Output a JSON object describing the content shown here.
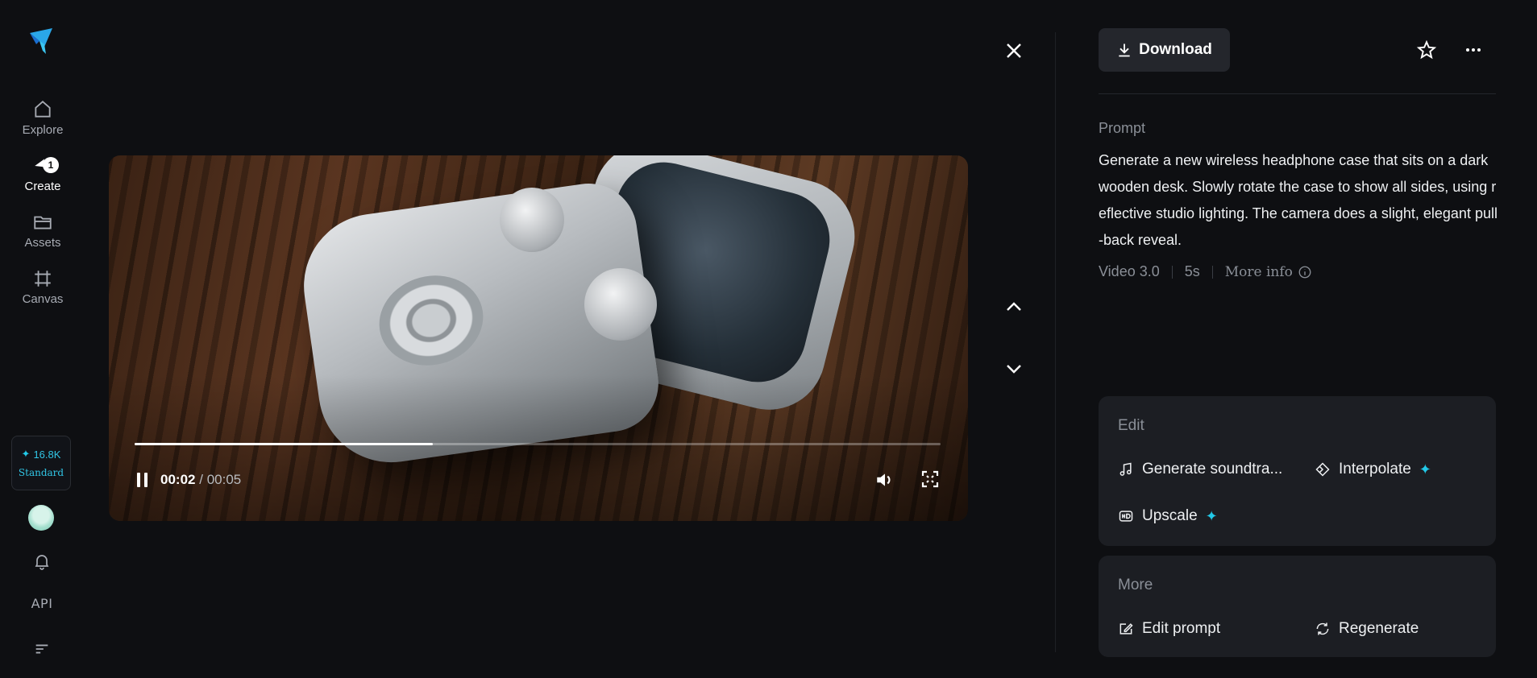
{
  "sidebar": {
    "logo": "brand-logo",
    "items": [
      {
        "label": "Explore",
        "icon": "home-icon"
      },
      {
        "label": "Create",
        "icon": "create-icon",
        "badge": "1"
      },
      {
        "label": "Assets",
        "icon": "folder-icon"
      },
      {
        "label": "Canvas",
        "icon": "canvas-icon"
      }
    ],
    "credits": {
      "amount": "16.8K",
      "plan": "Standard"
    },
    "api_label": "API"
  },
  "video": {
    "current_time": "00:02",
    "separator": "/",
    "total_time": "00:05",
    "progress": 0.37
  },
  "details": {
    "download_label": "Download",
    "prompt_label": "Prompt",
    "prompt_text": "Generate a new wireless headphone case that sits on a dark wooden desk. Slowly rotate the case to show all sides, using reflective studio lighting. The camera does a slight, elegant pull-back reveal.",
    "model": "Video 3.0",
    "duration": "5s",
    "more_info": "More info"
  },
  "edit_card": {
    "title": "Edit",
    "actions": [
      {
        "label": "Generate soundtra...",
        "icon": "music-note-icon"
      },
      {
        "label": "Interpolate",
        "icon": "interpolate-icon",
        "premium": true
      },
      {
        "label": "Upscale",
        "icon": "hd-icon",
        "premium": true
      }
    ]
  },
  "more_card": {
    "title": "More",
    "actions": [
      {
        "label": "Edit prompt",
        "icon": "edit-prompt-icon"
      },
      {
        "label": "Regenerate",
        "icon": "regenerate-icon"
      }
    ]
  },
  "colors": {
    "background": "#0e0f12",
    "card": "#1c1e23",
    "accent": "#22c9e8"
  }
}
